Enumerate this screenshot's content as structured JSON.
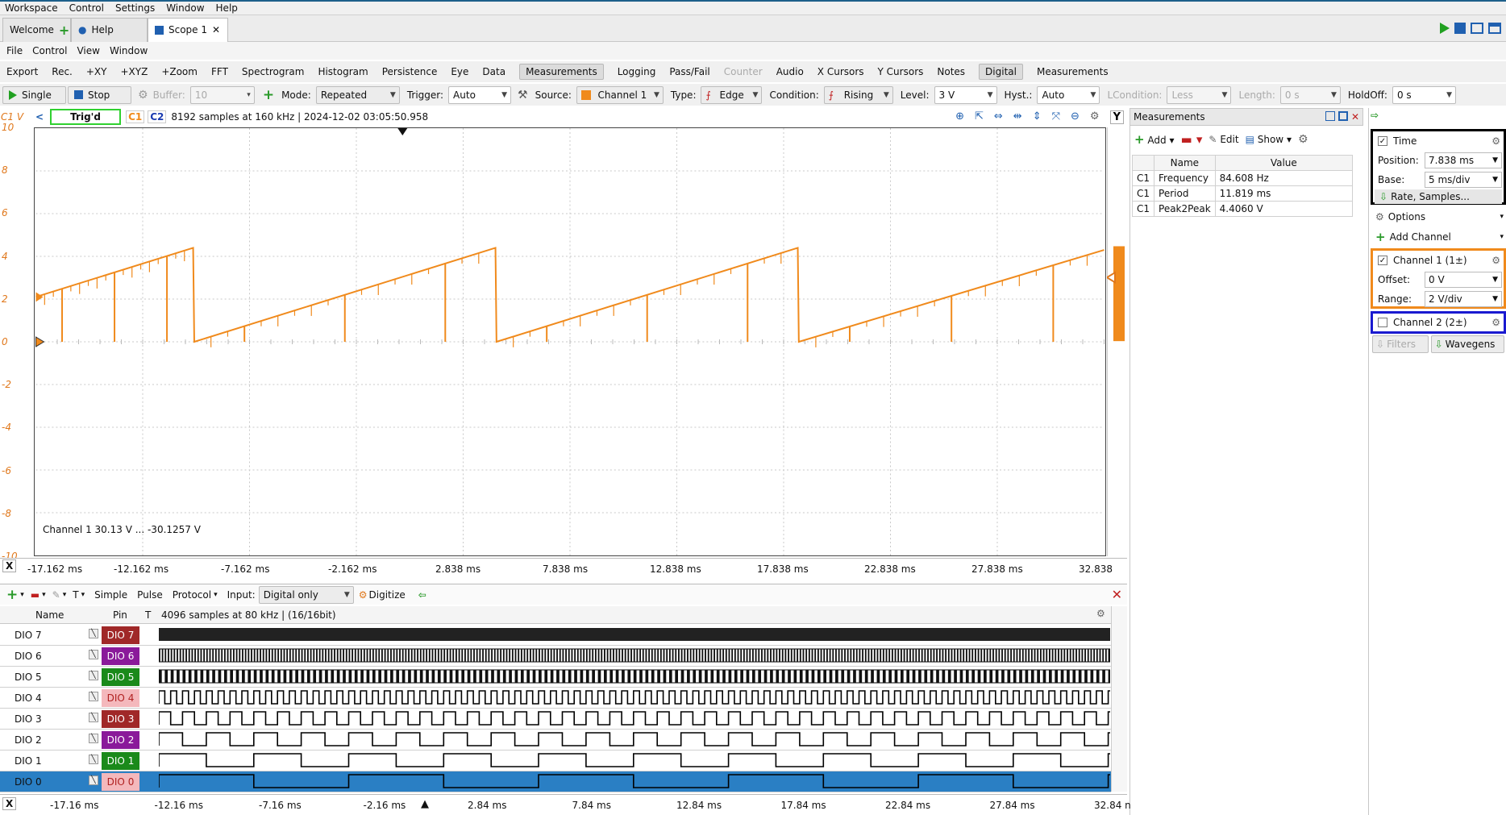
{
  "menubar": {
    "items": [
      "Workspace",
      "Control",
      "Settings",
      "Window",
      "Help"
    ]
  },
  "tabs": [
    {
      "label": "Welcome",
      "active": false
    },
    {
      "label": "Help",
      "active": false
    },
    {
      "label": "Scope 1",
      "active": true
    }
  ],
  "menubar2": {
    "items": [
      "File",
      "Control",
      "View",
      "Window"
    ]
  },
  "toolbar1": {
    "items": [
      {
        "label": "Export",
        "state": "normal"
      },
      {
        "label": "Rec.",
        "state": "normal"
      },
      {
        "label": "+XY",
        "state": "normal"
      },
      {
        "label": "+XYZ",
        "state": "normal"
      },
      {
        "label": "+Zoom",
        "state": "normal"
      },
      {
        "label": "FFT",
        "state": "normal"
      },
      {
        "label": "Spectrogram",
        "state": "normal"
      },
      {
        "label": "Histogram",
        "state": "normal"
      },
      {
        "label": "Persistence",
        "state": "normal"
      },
      {
        "label": "Eye",
        "state": "normal"
      },
      {
        "label": "Data",
        "state": "normal"
      },
      {
        "label": "Measurements",
        "state": "on"
      },
      {
        "label": "Logging",
        "state": "normal"
      },
      {
        "label": "Pass/Fail",
        "state": "normal"
      },
      {
        "label": "Counter",
        "state": "disabled"
      },
      {
        "label": "Audio",
        "state": "normal"
      },
      {
        "label": "X Cursors",
        "state": "normal"
      },
      {
        "label": "Y Cursors",
        "state": "normal"
      },
      {
        "label": "Notes",
        "state": "normal"
      },
      {
        "label": "Digital",
        "state": "on"
      },
      {
        "label": "Measurements",
        "state": "normal"
      }
    ]
  },
  "toolbar2": {
    "single": "Single",
    "stop": "Stop",
    "buffer_label": "Buffer:",
    "buffer_value": "10",
    "mode_label": "Mode:",
    "mode_value": "Repeated",
    "trigger_label": "Trigger:",
    "trigger_value": "Auto",
    "source_label": "Source:",
    "source_value": "Channel 1",
    "type_label": "Type:",
    "type_value": "Edge",
    "condition_label": "Condition:",
    "condition_value": "Rising",
    "level_label": "Level:",
    "level_value": "3 V",
    "hyst_label": "Hyst.:",
    "hyst_value": "Auto",
    "lcondition_label": "LCondition:",
    "lcondition_value": "Less",
    "length_label": "Length:",
    "length_value": "0 s",
    "holdoff_label": "HoldOff:",
    "holdoff_value": "0 s"
  },
  "scope": {
    "unit_label": "C1 V",
    "status": "Trig'd",
    "c1": "C1",
    "c2": "C2",
    "info": "8192 samples at 160 kHz | 2024-12-02 03:05:50.958",
    "channel_info": "Channel 1  30.13 V ... -30.1257 V",
    "y_ticks": [
      "10",
      "8",
      "6",
      "4",
      "2",
      "0",
      "-2",
      "-4",
      "-6",
      "-8",
      "-10"
    ],
    "x_ticks": [
      "-17.162 ms",
      "-12.162 ms",
      "-7.162 ms",
      "-2.162 ms",
      "2.838 ms",
      "7.838 ms",
      "12.838 ms",
      "17.838 ms",
      "22.838 ms",
      "27.838 ms",
      "32.838"
    ],
    "x_button": "X",
    "y_button": "Y",
    "trace_color": "#f08a1c"
  },
  "chart_data": {
    "type": "line",
    "title": "",
    "xlabel": "",
    "ylabel": "C1 V",
    "xlim": [
      -17.162,
      32.838
    ],
    "ylim": [
      -10,
      10
    ],
    "grid": true,
    "series": [
      {
        "name": "Channel 1",
        "x": [
          -17.162,
          -9.8,
          -9.75,
          4.35,
          4.4,
          18.5,
          18.55,
          32.838
        ],
        "values": [
          2.1,
          4.4,
          0.0,
          4.4,
          0.0,
          4.4,
          0.0,
          4.3
        ]
      }
    ]
  },
  "measurements": {
    "title": "Measurements",
    "add": "Add",
    "edit": "Edit",
    "show": "Show",
    "headers": [
      "Name",
      "Value"
    ],
    "rows": [
      {
        "ch": "C1",
        "name": "Frequency",
        "value": "84.608 Hz"
      },
      {
        "ch": "C1",
        "name": "Period",
        "value": "11.819 ms"
      },
      {
        "ch": "C1",
        "name": "Peak2Peak",
        "value": "4.4060 V"
      }
    ]
  },
  "side": {
    "time_label": "Time",
    "position_label": "Position:",
    "position_value": "7.838 ms",
    "base_label": "Base:",
    "base_value": "5 ms/div",
    "rate_label": "Rate, Samples...",
    "options_label": "Options",
    "add_channel_label": "Add Channel",
    "ch1_label": "Channel 1 (1±)",
    "offset_label": "Offset:",
    "offset_value": "0 V",
    "range_label": "Range:",
    "range_value": "2 V/div",
    "ch2_label": "Channel 2 (2±)",
    "filters_label": "Filters",
    "wavegens_label": "Wavegens"
  },
  "digital": {
    "toolbar": {
      "t": "T",
      "simple": "Simple",
      "pulse": "Pulse",
      "protocol": "Protocol",
      "input_label": "Input:",
      "input_value": "Digital only",
      "digitize": "Digitize"
    },
    "headers": {
      "name": "Name",
      "pin": "Pin",
      "t": "T"
    },
    "info": "4096 samples at 80 kHz |  (16/16bit)",
    "rows": [
      {
        "name": "DIO  7",
        "pin": "DIO  7",
        "pin_color": "#a02828",
        "periods": 0
      },
      {
        "name": "DIO  6",
        "pin": "DIO  6",
        "pin_color": "#8a1a9a",
        "periods": 0.8
      },
      {
        "name": "DIO  5",
        "pin": "DIO  5",
        "pin_color": "#1a8a1a",
        "periods": 1.6
      },
      {
        "name": "DIO  4",
        "pin": "DIO  4",
        "pin_color": "#f4b8bc",
        "periods": 3.2
      },
      {
        "name": "DIO  3",
        "pin": "DIO  3",
        "pin_color": "#a02828",
        "periods": 6.4
      },
      {
        "name": "DIO  2",
        "pin": "DIO  2",
        "pin_color": "#8a1a9a",
        "periods": 12.8
      },
      {
        "name": "DIO  1",
        "pin": "DIO  1",
        "pin_color": "#1a8a1a",
        "periods": 25.6
      },
      {
        "name": "DIO  0",
        "pin": "DIO  0",
        "pin_color": "#f4b8bc",
        "periods": 51.2,
        "selected": true
      }
    ],
    "x_ticks": [
      "-17.16 ms",
      "-12.16 ms",
      "-7.16 ms",
      "-2.16 ms",
      "2.84 ms",
      "7.84 ms",
      "12.84 ms",
      "17.84 ms",
      "22.84 ms",
      "27.84 ms",
      "32.84 n"
    ],
    "x_button": "X"
  }
}
